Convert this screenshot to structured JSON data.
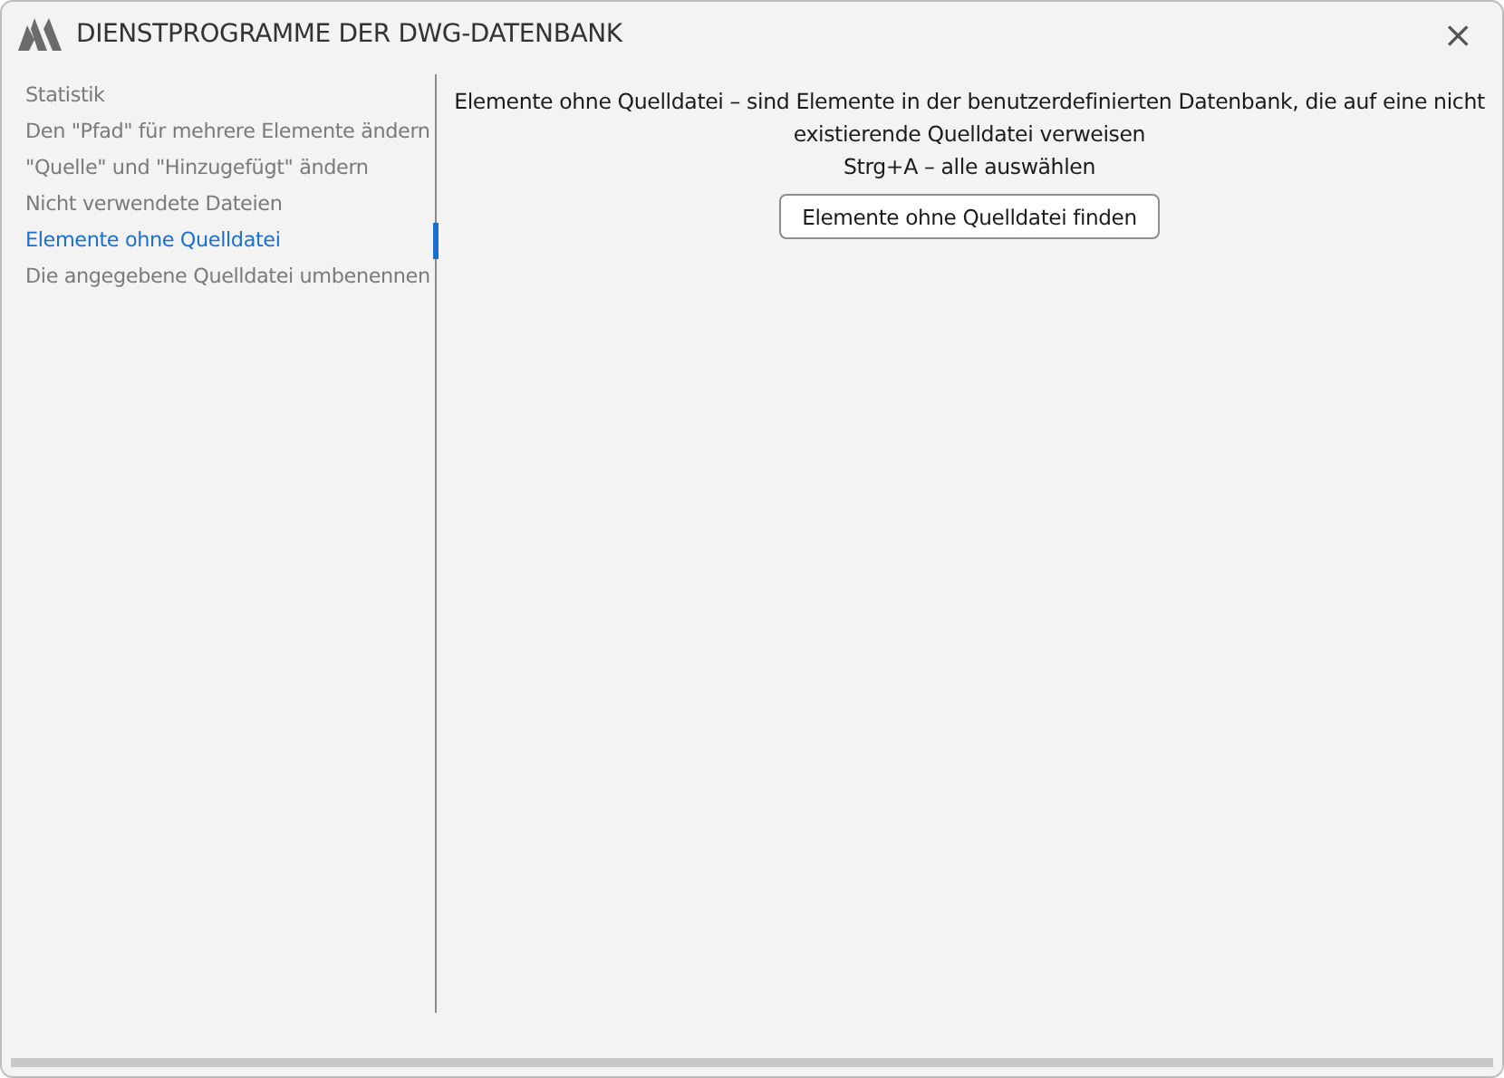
{
  "window": {
    "title": "DIENSTPROGRAMME DER DWG-DATENBANK",
    "close": "×"
  },
  "sidebar": {
    "items": [
      {
        "label": "Statistik",
        "selected": false
      },
      {
        "label": "Den \"Pfad\" für mehrere Elemente ändern",
        "selected": false
      },
      {
        "label": "\"Quelle\" und \"Hinzugefügt\" ändern",
        "selected": false
      },
      {
        "label": "Nicht verwendete Dateien",
        "selected": false
      },
      {
        "label": "Elemente ohne Quelldatei",
        "selected": true
      },
      {
        "label": "Die angegebene Quelldatei umbenennen",
        "selected": false
      }
    ]
  },
  "content": {
    "description": "Elemente ohne Quelldatei – sind Elemente in der benutzerdefinierten Datenbank, die auf eine nicht existierende Quelldatei verweisen",
    "shortcut": "Strg+A – alle auswählen",
    "button": "Elemente ohne Quelldatei finden"
  }
}
